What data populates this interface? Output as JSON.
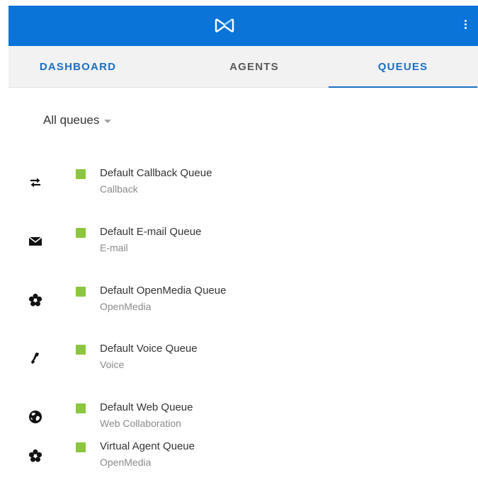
{
  "header": {
    "logo_icon": "genesys-infinity-logo-icon",
    "menu_icon": "kebab-menu-icon",
    "accent_color": "#0b74d8"
  },
  "tabs": [
    {
      "label": "DASHBOARD",
      "active": false
    },
    {
      "label": "AGENTS",
      "active": false
    },
    {
      "label": "QUEUES",
      "active": true
    }
  ],
  "filter": {
    "label": "All queues",
    "icon": "caret-down-icon"
  },
  "queues": [
    {
      "name": "Default Callback Queue",
      "type": "Callback",
      "icon": "callback-icon",
      "status_color": "#8cc63f"
    },
    {
      "name": "Default E-mail Queue",
      "type": "E-mail",
      "icon": "envelope-icon",
      "status_color": "#8cc63f"
    },
    {
      "name": "Default OpenMedia Queue",
      "type": "OpenMedia",
      "icon": "openmedia-icon",
      "status_color": "#8cc63f"
    },
    {
      "name": "Default Voice Queue",
      "type": "Voice",
      "icon": "phone-icon",
      "status_color": "#8cc63f"
    },
    {
      "name": "Default Web Queue",
      "type": "Web Collaboration",
      "icon": "globe-icon",
      "status_color": "#8cc63f"
    },
    {
      "name": "Virtual Agent Queue",
      "type": "OpenMedia",
      "icon": "openmedia-icon",
      "status_color": "#8cc63f"
    }
  ]
}
